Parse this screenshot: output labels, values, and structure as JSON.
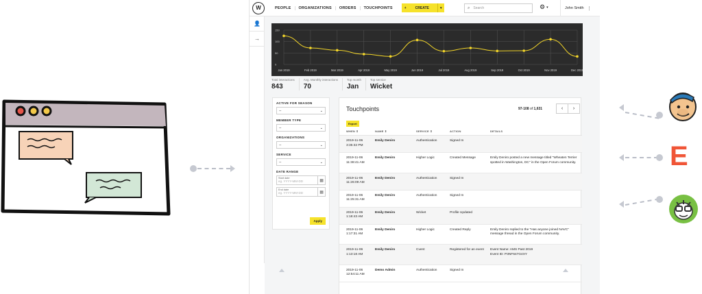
{
  "topbar": {
    "nav": [
      "PEOPLE",
      "ORGANIZATIONS",
      "ORDERS",
      "TOUCHPOINTS"
    ],
    "create_label": "CREATE",
    "search_placeholder": "Search",
    "user_name": "John Smith"
  },
  "chart_data": {
    "type": "line",
    "categories": [
      "Jan 2019",
      "Feb 2019",
      "Mar 2019",
      "Apr 2019",
      "May 2019",
      "Jun 2019",
      "Jul 2019",
      "Aug 2019",
      "Sep 2019",
      "Oct 2019",
      "Nov 2019",
      "Dec 2019"
    ],
    "values": [
      125,
      72,
      62,
      45,
      35,
      107,
      58,
      72,
      59,
      60,
      110,
      35
    ],
    "ylim": [
      0,
      150
    ],
    "yticks": [
      "150",
      "100",
      "50",
      "0"
    ],
    "line_color": "#f6d82a",
    "background": "#2b2b2b",
    "grid": true
  },
  "stats": [
    {
      "label": "Total interactions",
      "value": "843"
    },
    {
      "label": "Avg. Monthly interactions",
      "value": "70"
    },
    {
      "label": "Top month",
      "value": "Jan"
    },
    {
      "label": "Top service",
      "value": "Wicket"
    }
  ],
  "filters": {
    "active_for_season": "ACTIVE FOR SEASON",
    "member_type": "MEMBER TYPE",
    "organizations": "ORGANIZATIONS",
    "service": "SERVICE",
    "date_range": "DATE RANGE",
    "select_value": "--",
    "start_label": "Start date",
    "end_label": "End date",
    "date_placeholder": "eg. YYYY-MM-DD",
    "apply": "Apply"
  },
  "touchpoints": {
    "title": "Touchpoints",
    "range": "97-108",
    "of": "of",
    "total": "1,631",
    "export": "Export",
    "columns": [
      "WHEN",
      "NAME",
      "SERVICE",
      "ACTION",
      "DETAILS"
    ],
    "rows": [
      {
        "when": "2019-11-06 3:35:32 PM",
        "name": "Emily Deniro",
        "service": "Authentication",
        "action": "Signed In",
        "details": ""
      },
      {
        "when": "2019-11-06 11:38:41 AM",
        "name": "Emily Deniro",
        "service": "Higher Logic",
        "action": "Created Message",
        "details": "Emily Deniro posted a new message titled \"Wheaten Terrier spotted in Washington, DC\" in the Open Forum community."
      },
      {
        "when": "2019-11-06 11:26:09 AM",
        "name": "Emily Deniro",
        "service": "Authentication",
        "action": "Signed In",
        "details": ""
      },
      {
        "when": "2019-11-06 11:25:31 AM",
        "name": "Emily Deniro",
        "service": "Authentication",
        "action": "Signed In",
        "details": ""
      },
      {
        "when": "2019-11-06 1:18:43 AM",
        "name": "Emily Deniro",
        "service": "Wicket",
        "action": "Profile Updated",
        "details": ""
      },
      {
        "when": "2019-11-06 1:17:31 AM",
        "name": "Emily Deniro",
        "service": "Higher Logic",
        "action": "Created Reply",
        "details": "Emily Deniro replied to the \"Has anyone joined NAVC\" message thread in the Open Forum community."
      },
      {
        "when": "2019-11-06 1:13:18 AM",
        "name": "Emily Deniro",
        "service": "Cvent",
        "action": "Registered for an event",
        "details": "Event Name: AMS Past 2019\nEvent ID: P3NF647G4XY"
      },
      {
        "when": "2019-11-06 12:54:11 AM",
        "name": "Demo Admin",
        "service": "Authentication",
        "action": "Signed In",
        "details": ""
      }
    ]
  },
  "right_logos": {
    "eventbrite_letter": "E"
  }
}
